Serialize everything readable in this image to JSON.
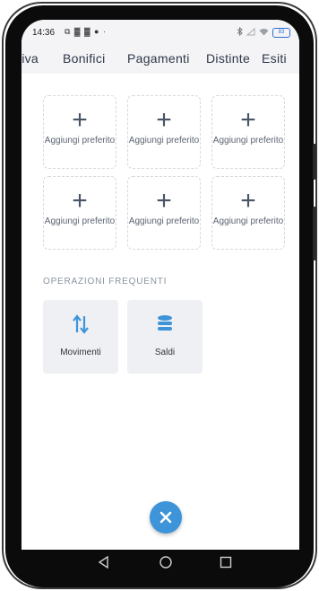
{
  "status_bar": {
    "time": "14:36",
    "left_icons": "⧉ ▓ ▓ ● ·",
    "battery": "83"
  },
  "tabs": [
    {
      "label": "tiva"
    },
    {
      "label": "Bonifici"
    },
    {
      "label": "Pagamenti"
    },
    {
      "label": "Distinte"
    },
    {
      "label": "Esiti"
    }
  ],
  "favorites": [
    {
      "plus": "+",
      "label": "Aggiungi preferito"
    },
    {
      "plus": "+",
      "label": "Aggiungi preferito"
    },
    {
      "plus": "+",
      "label": "Aggiungi preferito"
    },
    {
      "plus": "+",
      "label": "Aggiungi preferito"
    },
    {
      "plus": "+",
      "label": "Aggiungi preferito"
    },
    {
      "plus": "+",
      "label": "Aggiungi preferito"
    }
  ],
  "frequent": {
    "title": "OPERAZIONI FREQUENTI",
    "items": [
      {
        "label": "Movimenti",
        "icon": "transfer-arrows-icon"
      },
      {
        "label": "Saldi",
        "icon": "database-stack-icon"
      }
    ]
  },
  "fab": {
    "icon": "close-icon"
  },
  "navigation": {
    "back": "back-triangle-icon",
    "home": "home-circle-icon",
    "recents": "recents-square-icon"
  },
  "colors": {
    "accent": "#3d94d8",
    "tile_bg": "#eef0f3",
    "header_bg": "#f4f4f6"
  }
}
